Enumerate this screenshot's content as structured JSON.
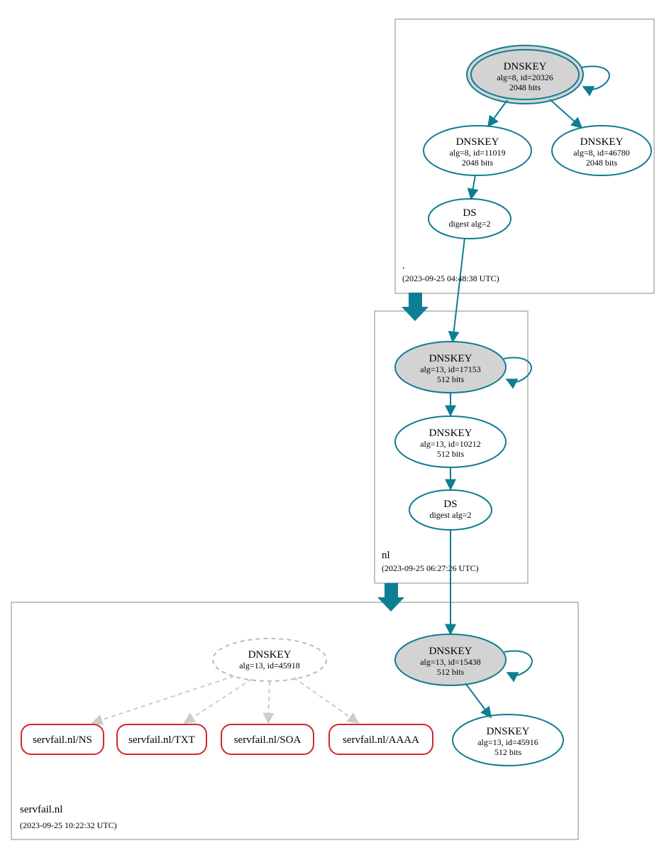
{
  "zones": {
    "root": {
      "label": ".",
      "timestamp": "(2023-09-25 04:48:38 UTC)"
    },
    "nl": {
      "label": "nl",
      "timestamp": "(2023-09-25 06:27:26 UTC)"
    },
    "servfail": {
      "label": "servfail.nl",
      "timestamp": "(2023-09-25 10:22:32 UTC)"
    }
  },
  "nodes": {
    "root_ksk": {
      "title": "DNSKEY",
      "l2": "alg=8, id=20326",
      "l3": "2048 bits"
    },
    "root_zsk": {
      "title": "DNSKEY",
      "l2": "alg=8, id=11019",
      "l3": "2048 bits"
    },
    "root_zsk2": {
      "title": "DNSKEY",
      "l2": "alg=8, id=46780",
      "l3": "2048 bits"
    },
    "root_ds": {
      "title": "DS",
      "l2": "digest alg=2"
    },
    "nl_ksk": {
      "title": "DNSKEY",
      "l2": "alg=13, id=17153",
      "l3": "512 bits"
    },
    "nl_zsk": {
      "title": "DNSKEY",
      "l2": "alg=13, id=10212",
      "l3": "512 bits"
    },
    "nl_ds": {
      "title": "DS",
      "l2": "digest alg=2"
    },
    "sf_ksk": {
      "title": "DNSKEY",
      "l2": "alg=13, id=15438",
      "l3": "512 bits"
    },
    "sf_zsk": {
      "title": "DNSKEY",
      "l2": "alg=13, id=45916",
      "l3": "512 bits"
    },
    "sf_missing": {
      "title": "DNSKEY",
      "l2": "alg=13, id=45918"
    },
    "rr_ns": {
      "label": "servfail.nl/NS"
    },
    "rr_txt": {
      "label": "servfail.nl/TXT"
    },
    "rr_soa": {
      "label": "servfail.nl/SOA"
    },
    "rr_aaaa": {
      "label": "servfail.nl/AAAA"
    }
  },
  "chart_data": {
    "type": "graph",
    "description": "DNSSEC authentication chain from root (.) → nl → servfail.nl. Solid teal ellipses are active DNSKEY/DS records; grey-filled ellipses are trust anchors (KSKs). The dashed grey DNSKEY alg=13 id=45918 in servfail.nl is missing and its dashed edges point to four red-bordered RRsets (NS, TXT, SOA, AAAA) indicating broken validation (SERVFAIL).",
    "zones": [
      {
        "name": ".",
        "timestamp": "2023-09-25 04:48:38 UTC"
      },
      {
        "name": "nl",
        "timestamp": "2023-09-25 06:27:26 UTC"
      },
      {
        "name": "servfail.nl",
        "timestamp": "2023-09-25 10:22:32 UTC"
      }
    ],
    "nodes": [
      {
        "id": "root_ksk",
        "zone": ".",
        "type": "DNSKEY",
        "alg": 8,
        "key_id": 20326,
        "bits": 2048,
        "role": "KSK",
        "trust_anchor": true
      },
      {
        "id": "root_zsk",
        "zone": ".",
        "type": "DNSKEY",
        "alg": 8,
        "key_id": 11019,
        "bits": 2048
      },
      {
        "id": "root_zsk2",
        "zone": ".",
        "type": "DNSKEY",
        "alg": 8,
        "key_id": 46780,
        "bits": 2048
      },
      {
        "id": "root_ds",
        "zone": ".",
        "type": "DS",
        "digest_alg": 2
      },
      {
        "id": "nl_ksk",
        "zone": "nl",
        "type": "DNSKEY",
        "alg": 13,
        "key_id": 17153,
        "bits": 512,
        "role": "KSK"
      },
      {
        "id": "nl_zsk",
        "zone": "nl",
        "type": "DNSKEY",
        "alg": 13,
        "key_id": 10212,
        "bits": 512
      },
      {
        "id": "nl_ds",
        "zone": "nl",
        "type": "DS",
        "digest_alg": 2
      },
      {
        "id": "sf_ksk",
        "zone": "servfail.nl",
        "type": "DNSKEY",
        "alg": 13,
        "key_id": 15438,
        "bits": 512,
        "role": "KSK"
      },
      {
        "id": "sf_zsk",
        "zone": "servfail.nl",
        "type": "DNSKEY",
        "alg": 13,
        "key_id": 45916,
        "bits": 512
      },
      {
        "id": "sf_missing",
        "zone": "servfail.nl",
        "type": "DNSKEY",
        "alg": 13,
        "key_id": 45918,
        "status": "missing"
      },
      {
        "id": "rr_ns",
        "zone": "servfail.nl",
        "type": "RRset",
        "name": "servfail.nl/NS",
        "status": "bogus"
      },
      {
        "id": "rr_txt",
        "zone": "servfail.nl",
        "type": "RRset",
        "name": "servfail.nl/TXT",
        "status": "bogus"
      },
      {
        "id": "rr_soa",
        "zone": "servfail.nl",
        "type": "RRset",
        "name": "servfail.nl/SOA",
        "status": "bogus"
      },
      {
        "id": "rr_aaaa",
        "zone": "servfail.nl",
        "type": "RRset",
        "name": "servfail.nl/AAAA",
        "status": "bogus"
      }
    ],
    "edges": [
      {
        "from": "root_ksk",
        "to": "root_ksk",
        "style": "self"
      },
      {
        "from": "root_ksk",
        "to": "root_zsk",
        "style": "solid"
      },
      {
        "from": "root_ksk",
        "to": "root_zsk2",
        "style": "solid"
      },
      {
        "from": "root_zsk",
        "to": "root_ds",
        "style": "solid"
      },
      {
        "from": "root_ds",
        "to": "nl_ksk",
        "style": "solid"
      },
      {
        "from": "nl_ksk",
        "to": "nl_ksk",
        "style": "self"
      },
      {
        "from": "nl_ksk",
        "to": "nl_zsk",
        "style": "solid"
      },
      {
        "from": "nl_zsk",
        "to": "nl_ds",
        "style": "solid"
      },
      {
        "from": "nl_ds",
        "to": "sf_ksk",
        "style": "solid"
      },
      {
        "from": "sf_ksk",
        "to": "sf_ksk",
        "style": "self"
      },
      {
        "from": "sf_ksk",
        "to": "sf_zsk",
        "style": "solid"
      },
      {
        "from": "sf_missing",
        "to": "rr_ns",
        "style": "dashed"
      },
      {
        "from": "sf_missing",
        "to": "rr_txt",
        "style": "dashed"
      },
      {
        "from": "sf_missing",
        "to": "rr_soa",
        "style": "dashed"
      },
      {
        "from": "sf_missing",
        "to": "rr_aaaa",
        "style": "dashed"
      }
    ],
    "delegations": [
      {
        "from_zone": ".",
        "to_zone": "nl"
      },
      {
        "from_zone": "nl",
        "to_zone": "servfail.nl"
      }
    ]
  }
}
